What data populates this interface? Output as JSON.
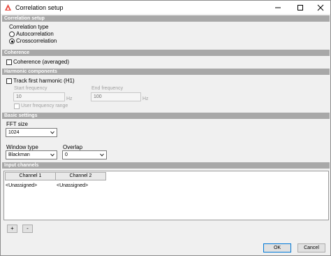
{
  "window": {
    "title": "Correlation setup"
  },
  "sections": {
    "correlation_setup": "Correlation setup",
    "coherence": "Coherence",
    "harmonic_components": "Harmonic components",
    "basic_settings": "Basic settings",
    "input_channels": "Input channels"
  },
  "correlation": {
    "type_label": "Correlation type",
    "options": [
      "Autocorrelation",
      "Crosscorrelation"
    ],
    "selected": "Crosscorrelation"
  },
  "coherence": {
    "checkbox_label": "Coherence (averaged)",
    "checked": false
  },
  "harmonic": {
    "track_label": "Track first harmonic (H1)",
    "track_checked": false,
    "start_label": "Start frequency",
    "start_value": "10",
    "end_label": "End frequency",
    "end_value": "100",
    "unit": "Hz",
    "user_range_label": "User frequency range",
    "user_range_checked": false
  },
  "basic": {
    "fft_label": "FFT size",
    "fft_value": "1024",
    "window_label": "Window type",
    "window_value": "Blackman",
    "overlap_label": "Overlap",
    "overlap_value": "0"
  },
  "channels": {
    "columns": [
      "Channel 1",
      "Channel 2"
    ],
    "values": [
      "<Unassigned>",
      "<Unassigned>"
    ],
    "add_label": "+",
    "remove_label": "-"
  },
  "buttons": {
    "ok": "OK",
    "cancel": "Cancel"
  },
  "colors": {
    "section_header": "#a8a8a8",
    "accent": "#0078d7",
    "app_icon": "#e8473c"
  }
}
